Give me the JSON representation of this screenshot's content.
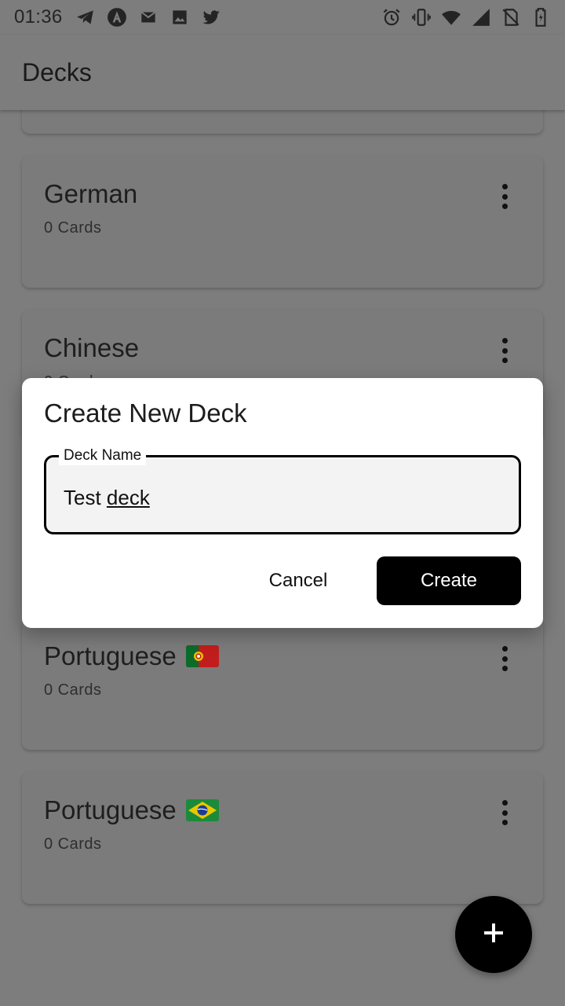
{
  "status_bar": {
    "time": "01:36",
    "left_icons": [
      "telegram-icon",
      "notification-a-icon",
      "mail-icon",
      "image-icon",
      "twitter-icon"
    ],
    "right_icons": [
      "alarm-icon",
      "vibrate-icon",
      "wifi-icon",
      "signal-icon",
      "no-sim-icon",
      "battery-icon"
    ]
  },
  "app_bar": {
    "title": "Decks"
  },
  "decks": [
    {
      "title": "German",
      "count": "0 Cards"
    },
    {
      "title": "Chinese",
      "count": "0 Cards"
    },
    {
      "title": "Portuguese",
      "count": "0 Cards",
      "flag": "portugal-flag"
    },
    {
      "title": "Portuguese",
      "count": "0 Cards",
      "flag": "brazil-flag"
    }
  ],
  "dialog": {
    "title": "Create New Deck",
    "field_label": "Deck Name",
    "field_value_plain": "Test ",
    "field_value_underlined": "deck",
    "cancel_label": "Cancel",
    "create_label": "Create"
  },
  "fab": {
    "icon": "plus-icon"
  },
  "colors": {
    "scrim_background": "#7d7d7d",
    "dialog_background": "#ffffff",
    "primary_button": "#000000",
    "fab": "#000000"
  }
}
